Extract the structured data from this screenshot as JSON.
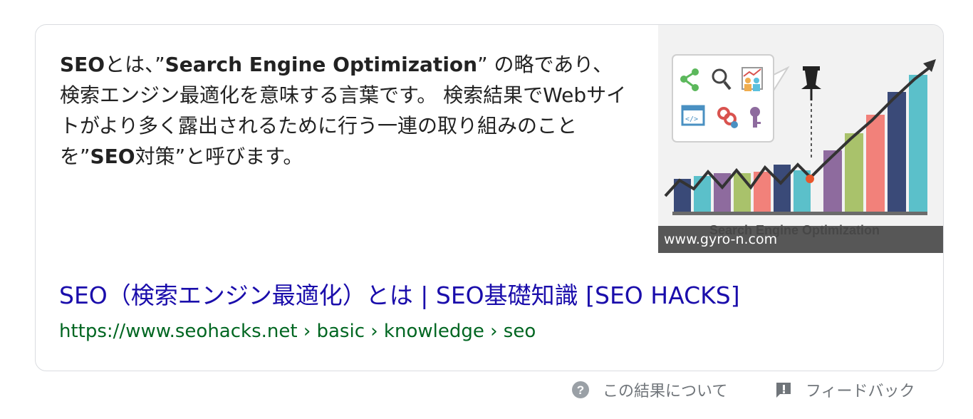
{
  "snippet": {
    "p1_bold": "SEO",
    "p2": "とは、”",
    "p3_bold": "Search Engine Optimization",
    "p4": "” の略であり、検索エンジン最適化を意味する言葉です。 検索結果でWebサイトがより多く露出されるために行う一連の取り組みのことを”",
    "p5_bold": "SEO",
    "p6": "対策”と呼びます。"
  },
  "thumbnail": {
    "caption": "www.gyro-n.com",
    "image_text": "Search Engine Optimization",
    "icons": [
      "share-icon",
      "search-icon",
      "people-chart-icon",
      "code-icon",
      "link-add-icon",
      "key-icon",
      "pushpin-icon"
    ]
  },
  "result": {
    "title": "SEO（検索エンジン最適化）とは | SEO基礎知識 [SEO HACKS]",
    "url": "https://www.seohacks.net › basic › knowledge › seo"
  },
  "footer": {
    "about": "この結果について",
    "feedback": "フィードバック"
  },
  "colors": {
    "link": "#1a0dab",
    "url": "#006621",
    "muted": "#70757a"
  }
}
